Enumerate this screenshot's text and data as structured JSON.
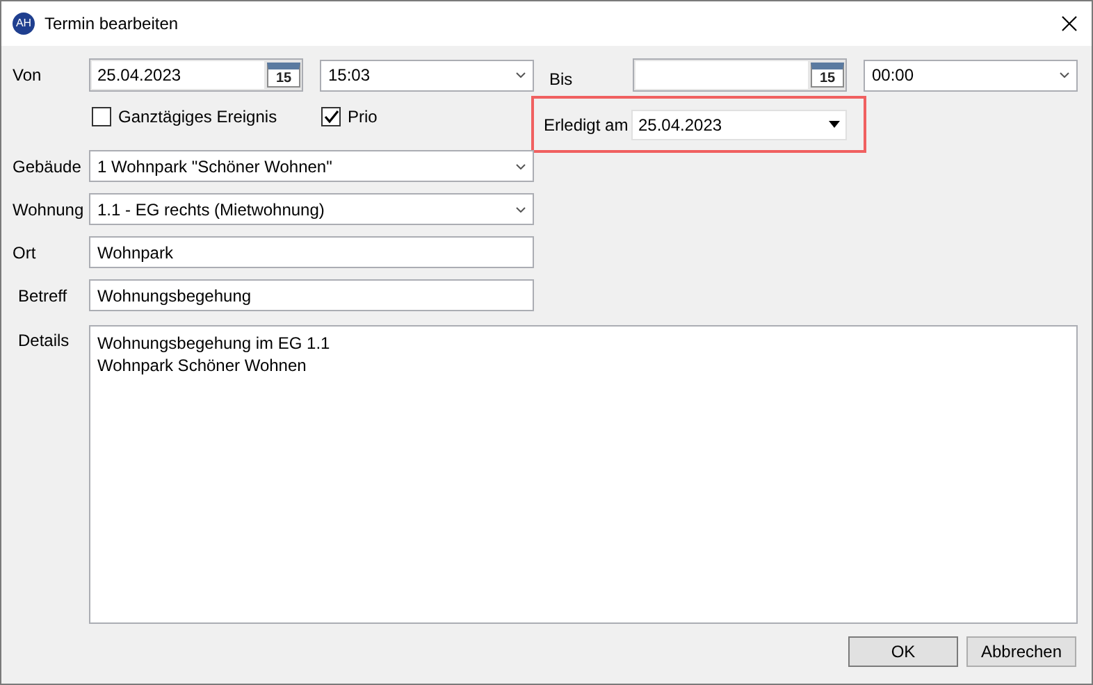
{
  "window": {
    "title": "Termin bearbeiten",
    "app_badge": "AH"
  },
  "von": {
    "label": "Von",
    "date": "25.04.2023",
    "calendar_day": "15",
    "time": "15:03"
  },
  "bis": {
    "label": "Bis",
    "calendar_day": "15",
    "time": "00:00"
  },
  "options": [
    {
      "label": "Ganztägiges Ereignis",
      "checked": false
    },
    {
      "label": "Prio",
      "checked": true
    }
  ],
  "erledigt": {
    "label": "Erledigt am",
    "value": "25.04.2023",
    "highlighted": true
  },
  "fields": [
    {
      "kind": "combo",
      "label": "Gebäude",
      "value": "1 Wohnpark \"Schöner Wohnen\""
    },
    {
      "kind": "combo",
      "label": "Wohnung",
      "value": "1.1 - EG rechts (Mietwohnung)"
    },
    {
      "kind": "text",
      "label": "Ort",
      "value": "Wohnpark"
    },
    {
      "kind": "text",
      "label": "Betreff",
      "value": "Wohnungsbegehung"
    }
  ],
  "details": {
    "label": "Details",
    "lines": [
      "Wohnungsbegehung im EG 1.1",
      "Wohnpark Schöner Wohnen"
    ]
  },
  "buttons": [
    "OK",
    "Abbrechen"
  ]
}
